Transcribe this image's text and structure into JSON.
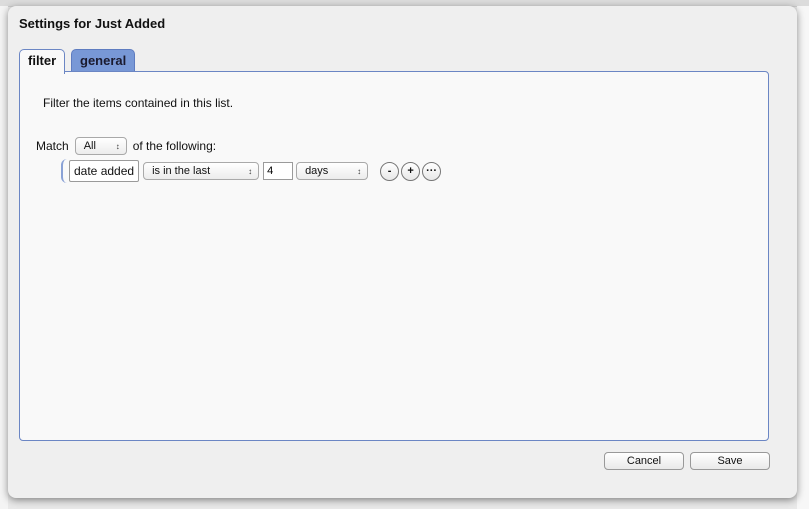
{
  "dialog": {
    "title": "Settings for Just Added",
    "tabs": [
      {
        "label": "filter",
        "active": true
      },
      {
        "label": "general",
        "active": false
      }
    ],
    "filter": {
      "description": "Filter the items contained in this list.",
      "match_label": "Match",
      "match_value": "All",
      "match_suffix": "of the following:",
      "rule": {
        "field": "date added",
        "operator": "is in the last",
        "value": "4",
        "unit": "days",
        "buttons": {
          "remove": "-",
          "add": "+",
          "more": "···"
        }
      }
    },
    "buttons": {
      "cancel": "Cancel",
      "save": "Save"
    }
  },
  "icons": {
    "select_arrows": "↕"
  }
}
